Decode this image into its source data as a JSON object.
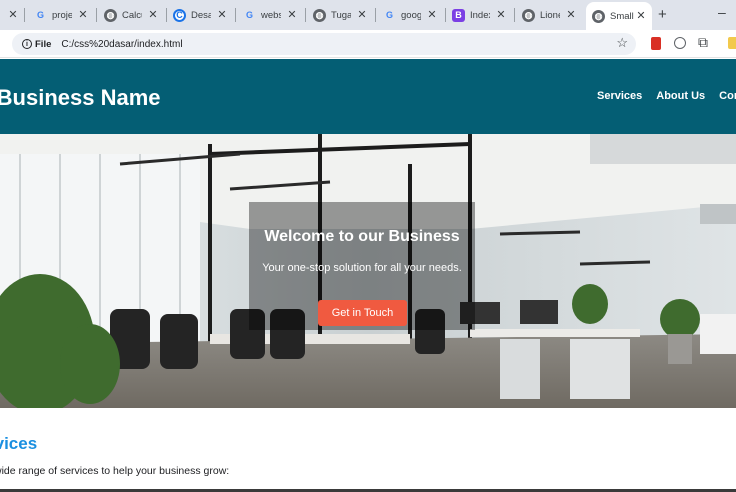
{
  "browser": {
    "tabs": [
      {
        "label": "",
        "icon": "close-icon"
      },
      {
        "label": "proje",
        "icon": "google-icon"
      },
      {
        "label": "Calcu",
        "icon": "globe-icon"
      },
      {
        "label": "Desai",
        "icon": "chrome-c-icon"
      },
      {
        "label": "websi",
        "icon": "google-icon"
      },
      {
        "label": "Tugas",
        "icon": "globe-icon"
      },
      {
        "label": "googl",
        "icon": "google-icon"
      },
      {
        "label": "Index",
        "icon": "bootstrap-icon"
      },
      {
        "label": "Lionel",
        "icon": "globe-icon"
      },
      {
        "label": "Small",
        "icon": "globe-icon",
        "active": true
      }
    ],
    "new_tab": "+",
    "minimize": "–",
    "site_info": "File",
    "url": "C:/css%20dasar/index.html",
    "bookmark_star": "☆"
  },
  "header": {
    "brand": "r Business Name",
    "nav": [
      "Services",
      "About Us",
      "Cor"
    ]
  },
  "hero": {
    "title": "Welcome to our Business",
    "subtitle": "Your one-stop solution for all your needs.",
    "cta": "Get in Touch"
  },
  "services": {
    "title": "rvices",
    "text": "wide range of services to help your business grow:"
  },
  "colors": {
    "header_bg": "#045e74",
    "cta_bg": "#f05a40",
    "services_title": "#1a8fe0"
  }
}
